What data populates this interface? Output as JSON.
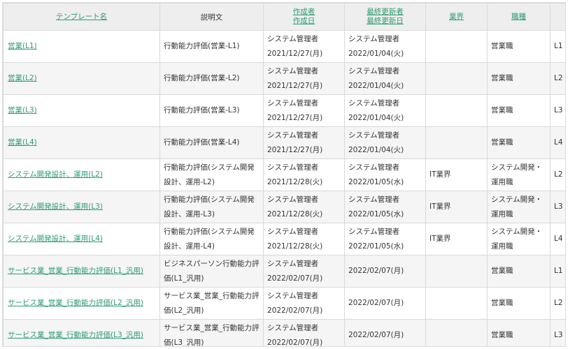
{
  "header": {
    "template_name": "テンプレート名",
    "description": "説明文",
    "created_by": "作成者",
    "created_date": "作成日",
    "updated_by": "最終更新者",
    "updated_date": "最終更新日",
    "industry": "業界",
    "job_type": "職種"
  },
  "rows": [
    {
      "name": "営業(L1)",
      "description": "行動能力評価(営業-L1)",
      "creator": "システム管理者",
      "created": "2021/12/27(月)",
      "updater": "システム管理者",
      "updated": "2022/01/04(火)",
      "industry": "",
      "job": "営業職",
      "level": "L1"
    },
    {
      "name": "営業(L2)",
      "description": "行動能力評価(営業-L2)",
      "creator": "システム管理者",
      "created": "2021/12/27(月)",
      "updater": "システム管理者",
      "updated": "2022/01/04(火)",
      "industry": "",
      "job": "営業職",
      "level": "L2"
    },
    {
      "name": "営業(L3)",
      "description": "行動能力評価(営業-L3)",
      "creator": "システム管理者",
      "created": "2021/12/27(月)",
      "updater": "システム管理者",
      "updated": "2022/01/04(火)",
      "industry": "",
      "job": "営業職",
      "level": "L3"
    },
    {
      "name": "営業(L4)",
      "description": "行動能力評価(営業-L4)",
      "creator": "システム管理者",
      "created": "2021/12/27(月)",
      "updater": "システム管理者",
      "updated": "2022/01/04(火)",
      "industry": "",
      "job": "営業職",
      "level": "L4"
    },
    {
      "name": "システム開発設計、運用(L2)",
      "description": "行動能力評価(システム開発設計、運用-L2)",
      "creator": "システム管理者",
      "created": "2021/12/28(火)",
      "updater": "システム管理者",
      "updated": "2022/01/05(水)",
      "industry": "IT業界",
      "job": "システム開発・運用職",
      "level": "L2"
    },
    {
      "name": "システム開発設計、運用(L3)",
      "description": "行動能力評価(システム開発設計、運用-L3)",
      "creator": "システム管理者",
      "created": "2021/12/28(火)",
      "updater": "システム管理者",
      "updated": "2022/01/05(水)",
      "industry": "IT業界",
      "job": "システム開発・運用職",
      "level": "L3"
    },
    {
      "name": "システム開発設計、運用(L4)",
      "description": "行動能力評価(システム開発設計、運用-L4)",
      "creator": "システム管理者",
      "created": "2021/12/28(火)",
      "updater": "システム管理者",
      "updated": "2022/01/05(水)",
      "industry": "IT業界",
      "job": "システム開発・運用職",
      "level": "L4"
    },
    {
      "name": "サービス業_営業_行動能力評価(L1_汎用)",
      "description": "ビジネスパーソン行動能力評価(L1_汎用)",
      "creator": "システム管理者",
      "created": "2022/02/07(月)",
      "updater": "",
      "updated": "2022/02/07(月)",
      "industry": "",
      "job": "営業職",
      "level": "L1"
    },
    {
      "name": "サービス業_営業_行動能力評価(L2_汎用)",
      "description": "サービス業_営業_行動能力評価(L2_汎用)",
      "creator": "システム管理者",
      "created": "2022/02/07(月)",
      "updater": "",
      "updated": "2022/02/07(月)",
      "industry": "",
      "job": "営業職",
      "level": "L2"
    },
    {
      "name": "サービス業_営業_行動能力評価(L3_汎用)",
      "description": "サービス業_営業_行動能力評価(L3_汎用)",
      "creator": "システム管理者",
      "created": "2022/02/07(月)",
      "updater": "",
      "updated": "2022/02/07(月)",
      "industry": "",
      "job": "営業職",
      "level": "L3"
    }
  ]
}
